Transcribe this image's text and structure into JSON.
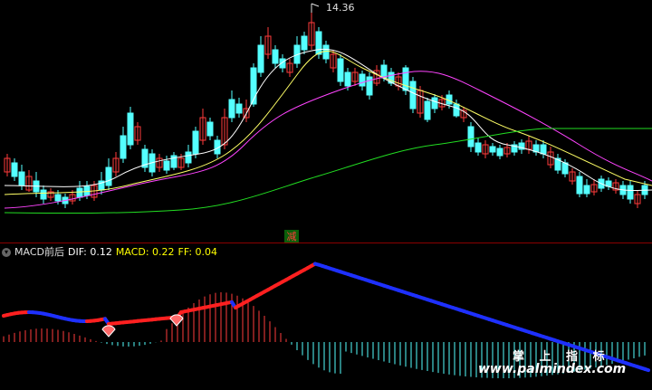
{
  "price_panel": {
    "high_label": "14.36",
    "signal_box": "减",
    "colors": {
      "up": "#ff3b3b",
      "down": "#54ffff",
      "ma5": "#ffffff",
      "ma10": "#ffff66",
      "ma20": "#ff44ff",
      "ma60": "#22dd22"
    }
  },
  "macd_panel": {
    "title": "MACD前后",
    "dif_label": "DIF: 0.12",
    "macd_label": "MACD: 0.22",
    "ff_label": "FF: 0.04",
    "colors": {
      "dif_up": "#ff2020",
      "dif_down": "#1e30ff",
      "bar_pos": "#ff3b3b",
      "bar_neg": "#54ffff"
    }
  },
  "watermark": {
    "line1": "掌 上 指 标",
    "line2": "www.palmindex.com"
  },
  "chart_data": {
    "type": "candlestick",
    "series": [
      {
        "name": "price",
        "values": []
      }
    ]
  }
}
